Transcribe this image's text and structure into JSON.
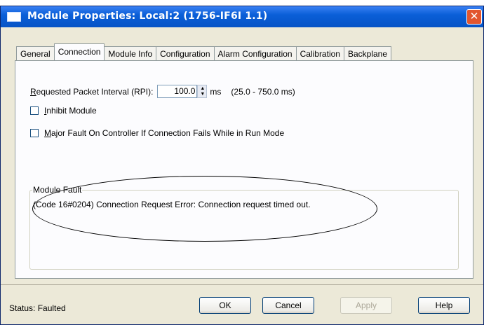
{
  "window": {
    "title": "Module Properties: Local:2 (1756-IF6I 1.1)",
    "close_glyph": "✕"
  },
  "tabs": [
    {
      "label": "General",
      "active": false
    },
    {
      "label": "Connection",
      "active": true
    },
    {
      "label": "Module Info",
      "active": false
    },
    {
      "label": "Configuration",
      "active": false
    },
    {
      "label": "Alarm Configuration",
      "active": false
    },
    {
      "label": "Calibration",
      "active": false
    },
    {
      "label": "Backplane",
      "active": false
    }
  ],
  "connection": {
    "rpi": {
      "label_mnemonic": "R",
      "label_rest": "equested Packet Interval (RPI):",
      "value": "100.0",
      "unit": "ms",
      "range": "(25.0 - 750.0 ms)"
    },
    "inhibit": {
      "mnemonic": "I",
      "rest": "nhibit Module",
      "checked": false
    },
    "major_fault": {
      "mnemonic": "M",
      "rest": "ajor Fault On Controller If Connection Fails While in Run Mode",
      "checked": false
    },
    "module_fault": {
      "legend": "Module Fault",
      "text": "(Code 16#0204) Connection Request Error: Connection request timed out."
    }
  },
  "status": {
    "label": "Status:",
    "value": "Faulted"
  },
  "buttons": {
    "ok": "OK",
    "cancel": "Cancel",
    "apply": "Apply",
    "help": "Help"
  }
}
